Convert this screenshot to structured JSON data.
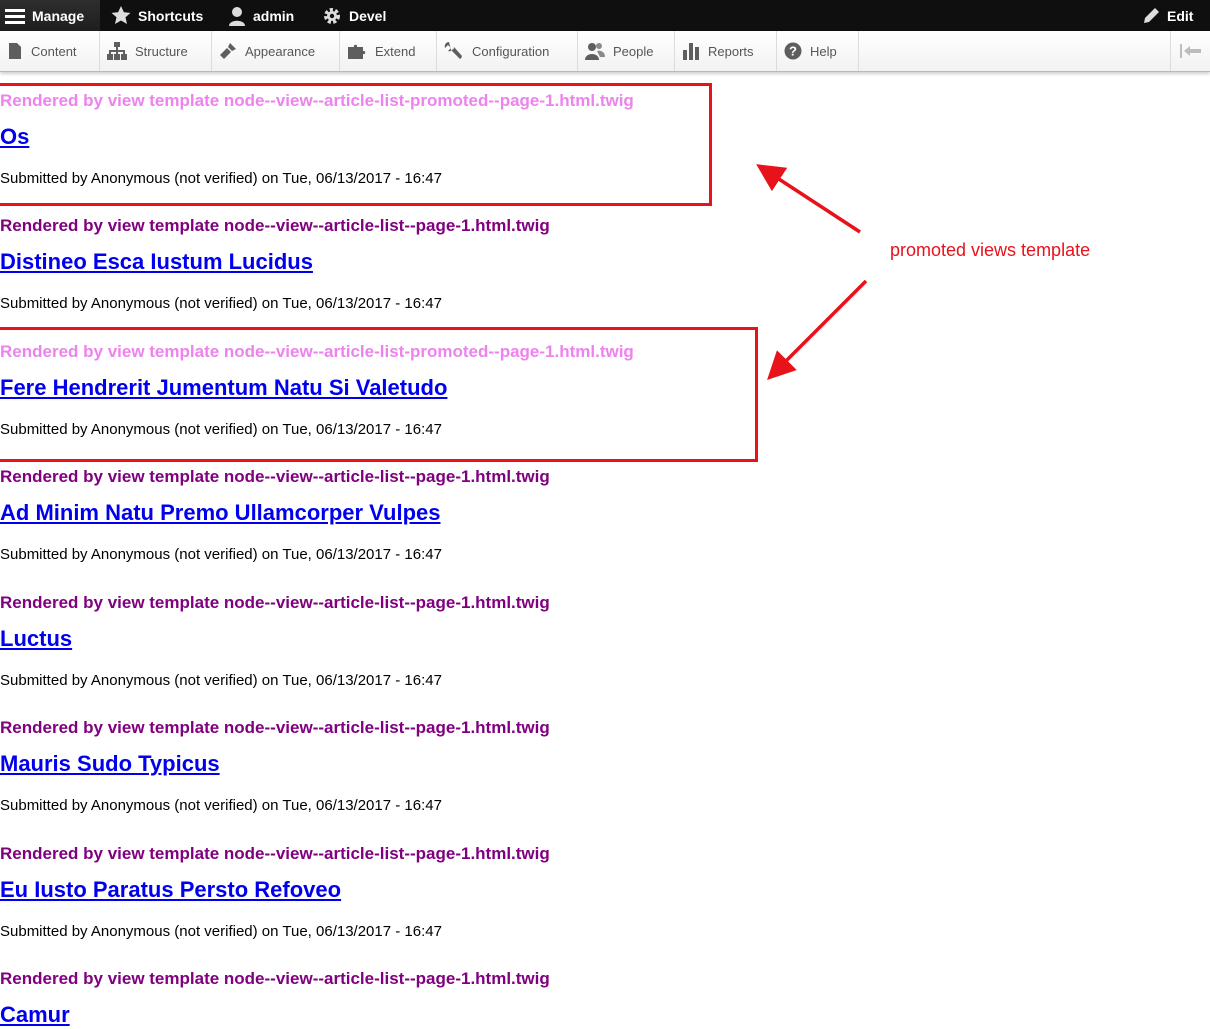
{
  "toolbar": {
    "manage": "Manage",
    "shortcuts": "Shortcuts",
    "user": "admin",
    "devel": "Devel",
    "edit": "Edit"
  },
  "tray": {
    "items": [
      {
        "label": "Content",
        "icon": "file-icon"
      },
      {
        "label": "Structure",
        "icon": "sitemap-icon"
      },
      {
        "label": "Appearance",
        "icon": "paintbrush-icon"
      },
      {
        "label": "Extend",
        "icon": "puzzle-icon"
      },
      {
        "label": "Configuration",
        "icon": "wrench-icon"
      },
      {
        "label": "People",
        "icon": "people-icon"
      },
      {
        "label": "Reports",
        "icon": "bar-chart-icon"
      },
      {
        "label": "Help",
        "icon": "help-icon"
      }
    ]
  },
  "nodes": [
    {
      "template": "Rendered by view template node--view--article-list-promoted--page-1.html.twig",
      "title": "Os",
      "submitted": "Submitted by Anonymous (not verified) on Tue, 06/13/2017 - 16:47",
      "promoted": true
    },
    {
      "template": "Rendered by view template node--view--article-list--page-1.html.twig",
      "title": "Distineo Esca Iustum Lucidus",
      "submitted": "Submitted by Anonymous (not verified) on Tue, 06/13/2017 - 16:47",
      "promoted": false
    },
    {
      "template": "Rendered by view template node--view--article-list-promoted--page-1.html.twig",
      "title": "Fere Hendrerit Jumentum Natu Si Valetudo",
      "submitted": "Submitted by Anonymous (not verified) on Tue, 06/13/2017 - 16:47",
      "promoted": true
    },
    {
      "template": "Rendered by view template node--view--article-list--page-1.html.twig",
      "title": "Ad Minim Natu Premo Ullamcorper Vulpes",
      "submitted": "Submitted by Anonymous (not verified) on Tue, 06/13/2017 - 16:47",
      "promoted": false
    },
    {
      "template": "Rendered by view template node--view--article-list--page-1.html.twig",
      "title": "Luctus",
      "submitted": "Submitted by Anonymous (not verified) on Tue, 06/13/2017 - 16:47",
      "promoted": false
    },
    {
      "template": "Rendered by view template node--view--article-list--page-1.html.twig",
      "title": "Mauris Sudo Typicus",
      "submitted": "Submitted by Anonymous (not verified) on Tue, 06/13/2017 - 16:47",
      "promoted": false
    },
    {
      "template": "Rendered by view template node--view--article-list--page-1.html.twig",
      "title": "Eu Iusto Paratus Persto Refoveo",
      "submitted": "Submitted by Anonymous (not verified) on Tue, 06/13/2017 - 16:47",
      "promoted": false
    },
    {
      "template": "Rendered by view template node--view--article-list--page-1.html.twig",
      "title": "Camur",
      "submitted": "",
      "promoted": false
    }
  ],
  "annotation": {
    "label": "promoted views template",
    "color": "#e8121b"
  },
  "colors": {
    "template_text": "#800080",
    "template_text_promoted": "#ee82ee",
    "link": "#0000ee",
    "toolbar_bg": "#0f0f0f"
  }
}
